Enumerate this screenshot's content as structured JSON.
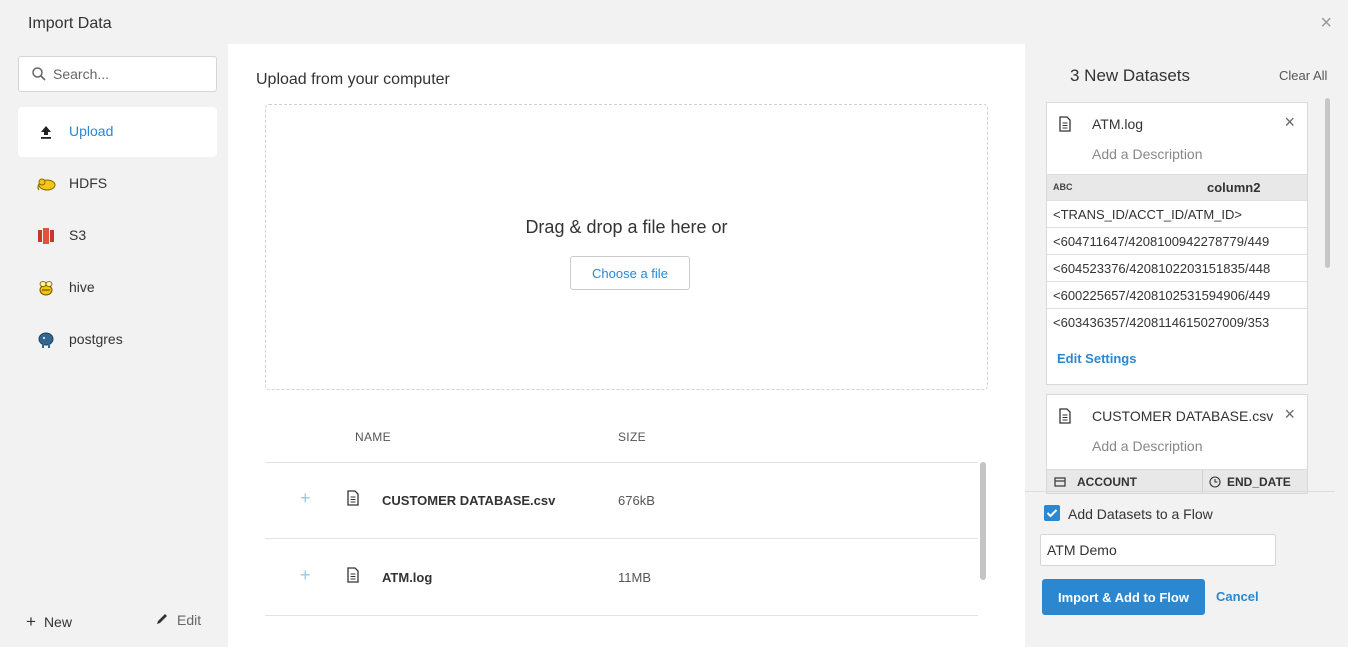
{
  "dialog": {
    "title": "Import Data",
    "close_glyph": "×"
  },
  "sidebar": {
    "search": {
      "placeholder": "Search..."
    },
    "items": [
      {
        "label": "Upload",
        "icon": "upload-icon",
        "active": true
      },
      {
        "label": "HDFS",
        "icon": "hdfs-elephant-icon"
      },
      {
        "label": "S3",
        "icon": "s3-icon"
      },
      {
        "label": "hive",
        "icon": "hive-bee-icon"
      },
      {
        "label": "postgres",
        "icon": "postgres-elephant-icon"
      }
    ],
    "new_label": "New",
    "edit_label": "Edit"
  },
  "main": {
    "heading": "Upload from your computer",
    "drop_text": "Drag & drop a file here or",
    "choose_label": "Choose a file",
    "columns": {
      "name": "NAME",
      "size": "SIZE"
    },
    "files": [
      {
        "name": "CUSTOMER DATABASE.csv",
        "size": "676kB"
      },
      {
        "name": "ATM.log",
        "size": "11MB"
      }
    ]
  },
  "right": {
    "title": "3 New Datasets",
    "clear_all": "Clear All",
    "card1": {
      "name": "ATM.log",
      "description": "Add a Description",
      "type_badge": "ABC",
      "column": "column2",
      "rows": [
        "<TRANS_ID/ACCT_ID/ATM_ID>",
        "<604711647/4208100942278779/449",
        "<604523376/4208102203151835/448",
        "<600225657/4208102531594906/449",
        "<603436357/4208114615027009/353"
      ],
      "edit_settings": "Edit Settings"
    },
    "card2": {
      "name": "CUSTOMER DATABASE.csv",
      "description": "Add a Description",
      "col1": "ACCOUNT",
      "col2": "END_DATE"
    },
    "add_to_flow_label": "Add Datasets to a Flow",
    "flow_name": "ATM Demo",
    "import_label": "Import & Add to Flow",
    "cancel_label": "Cancel"
  },
  "colors": {
    "accent": "#2a87d0",
    "panel_bg": "#f2f2f2"
  }
}
